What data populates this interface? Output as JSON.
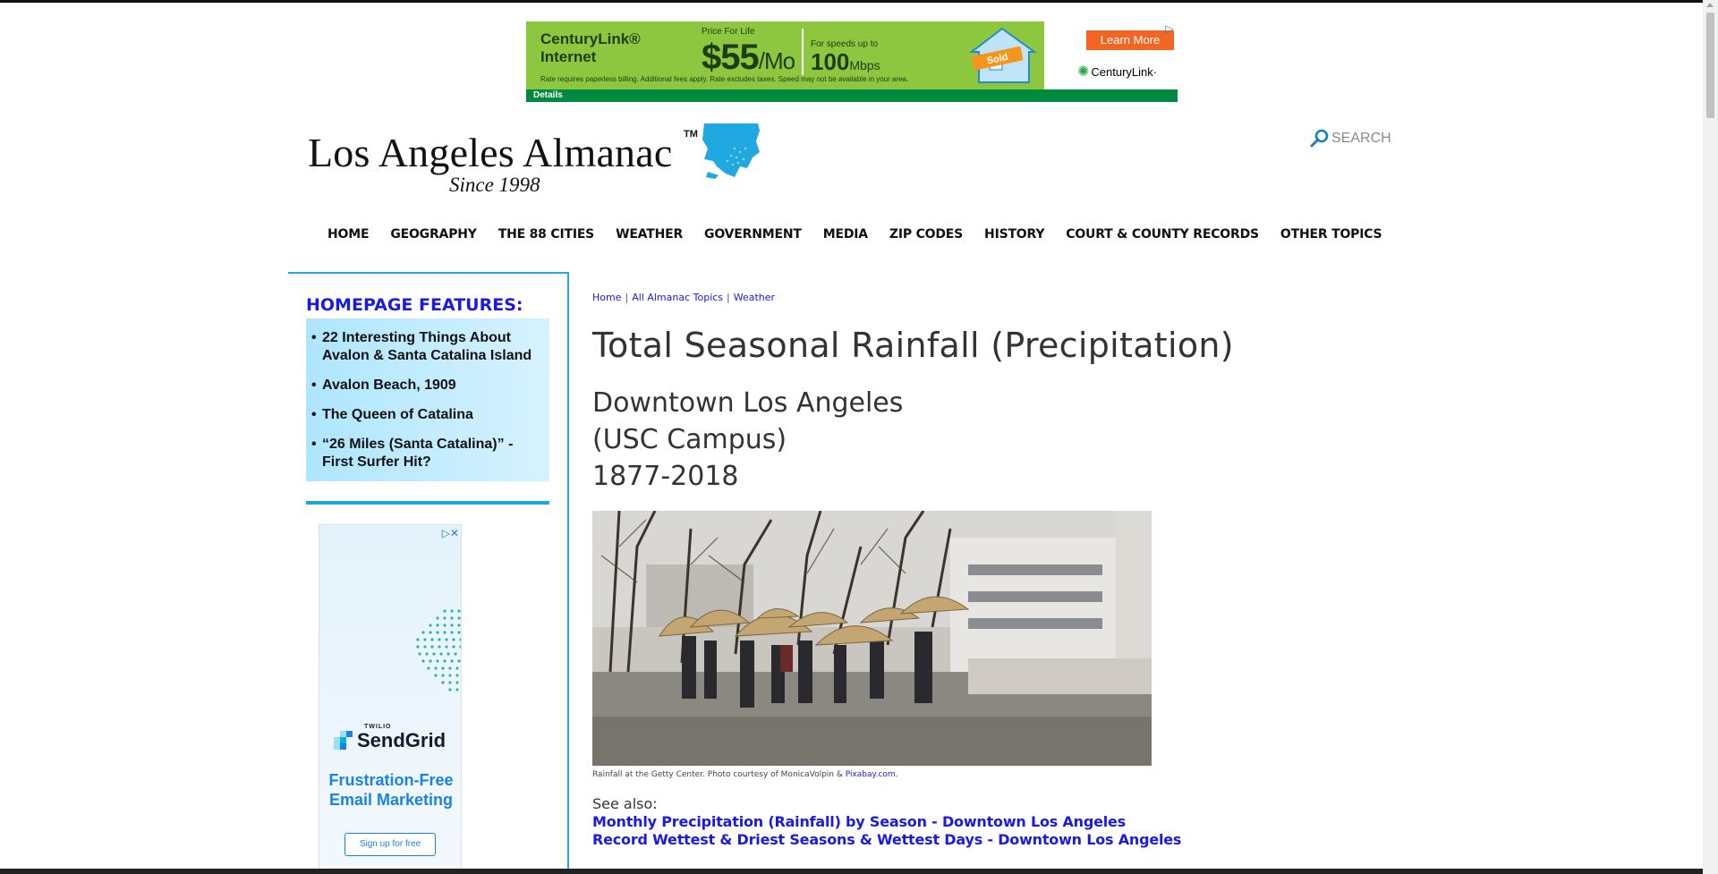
{
  "top_ad": {
    "brand": "CenturyLink® Internet",
    "price_for_life": "Price For Life",
    "price": "$55",
    "price_unit": "/Mo",
    "speed_label": "For speeds up to",
    "speed": "100",
    "speed_unit": "Mbps",
    "house_badge": "Sold",
    "learn_more": "Learn More",
    "logo": "CenturyLink·",
    "fine_print": "Rate requires paperless billing. Additional fees apply. Rate excludes taxes. Speed may not be available in your area.",
    "details": "Details",
    "ad_choices_icon": "ad-choices-icon",
    "colors": {
      "background": "#8dc63f",
      "button": "#f26522",
      "bar": "#008a3f"
    }
  },
  "logo": {
    "title": "Los Angeles Almanac",
    "tm": "TM",
    "since": "Since 1998",
    "map_icon": "la-county-map-icon",
    "map_color": "#1fa9e0"
  },
  "search": {
    "label": "SEARCH",
    "icon": "search-icon"
  },
  "nav": {
    "items": [
      {
        "label": "HOME"
      },
      {
        "label": "GEOGRAPHY"
      },
      {
        "label": "THE 88 CITIES"
      },
      {
        "label": "WEATHER"
      },
      {
        "label": "GOVERNMENT"
      },
      {
        "label": "MEDIA"
      },
      {
        "label": "ZIP CODES"
      },
      {
        "label": "HISTORY"
      },
      {
        "label": "COURT & COUNTY RECORDS"
      },
      {
        "label": "OTHER TOPICS"
      }
    ]
  },
  "sidebar": {
    "features_title": "HOMEPAGE FEATURES:",
    "features": [
      {
        "bullet": "•",
        "text": "22 Interesting Things About Avalon & Santa Catalina Island"
      },
      {
        "bullet": "•",
        "text": "Avalon Beach, 1909"
      },
      {
        "bullet": "•",
        "text": "The Queen of Catalina"
      },
      {
        "bullet": "•",
        "text": "“26 Miles (Santa Catalina)” - First Surfer Hit?"
      }
    ],
    "accent_color": "#1fa9e0",
    "title_color": "#1a1ae6"
  },
  "side_ad": {
    "twilio": "TWILIO",
    "brand": "SendGrid",
    "headline": "Frustration-Free Email Marketing",
    "cta": "Sign up for free",
    "ad_choices_icon": "ad-choices-icon",
    "accent_color": "#1a82e2"
  },
  "breadcrumb": {
    "items": [
      {
        "label": "Home"
      },
      {
        "label": "All Almanac Topics"
      },
      {
        "label": "Weather"
      }
    ],
    "separator": "|"
  },
  "main": {
    "title": "Total Seasonal Rainfall (Precipitation)",
    "subtitle_lines": [
      "Downtown Los Angeles",
      "(USC Campus)",
      "1877-2018"
    ],
    "photo_alt": "Rainfall at the Getty Center",
    "caption_text": "Rainfall at the Getty Center. Photo courtesy of MonicaVolpin & ",
    "caption_link": "Pixabay.com",
    "caption_end": ".",
    "see_also_label": "See also:",
    "see_also_links": [
      {
        "label": "Monthly Precipitation (Rainfall) by Season - Downtown Los Angeles"
      },
      {
        "label": "Record Wettest & Driest Seasons & Wettest Days - Downtown Los Angeles"
      }
    ]
  }
}
